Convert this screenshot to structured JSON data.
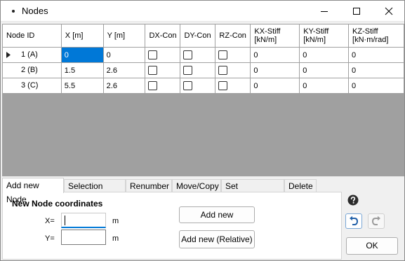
{
  "window": {
    "title": "Nodes",
    "icon": "dot-icon"
  },
  "table": {
    "columns": [
      "Node ID",
      "X [m]",
      "Y [m]",
      "DX-Con",
      "DY-Con",
      "RZ-Con",
      "KX-Stiff\n[kN/m]",
      "KY-Stiff\n[kN/m]",
      "KZ-Stiff\n[kN·m/rad]"
    ],
    "rows": [
      {
        "id": "1 (A)",
        "x": "0",
        "y": "0",
        "kx": "0",
        "ky": "0",
        "kz": "0"
      },
      {
        "id": "2 (B)",
        "x": "1.5",
        "y": "2.6",
        "kx": "0",
        "ky": "0",
        "kz": "0"
      },
      {
        "id": "3 (C)",
        "x": "5.5",
        "y": "2.6",
        "kx": "0",
        "ky": "0",
        "kz": "0"
      }
    ]
  },
  "tabs": [
    "Add new Node",
    "Selection tools",
    "Renumber",
    "Move/Copy",
    "Set Constraints",
    "Delete"
  ],
  "panel": {
    "title": "New Node coordinates",
    "x_label": "X=",
    "y_label": "Y=",
    "x_value": "",
    "y_value": "",
    "unit": "m",
    "add_new": "Add new",
    "add_new_relative": "Add new (Relative)"
  },
  "side": {
    "ok": "OK"
  },
  "colors": {
    "selection": "#0078d7",
    "grid_background": "#a0a0a0"
  }
}
